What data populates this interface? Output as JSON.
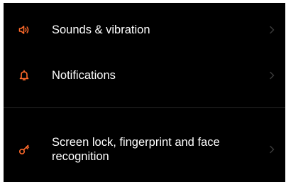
{
  "accent_color": "#ff6a2b",
  "settings": {
    "items": [
      {
        "label": "Sounds & vibration",
        "icon": "speaker-icon"
      },
      {
        "label": "Notifications",
        "icon": "bell-icon"
      },
      {
        "label": "Screen lock, fingerprint and face recognition",
        "icon": "key-icon"
      }
    ],
    "chevron_icon": "chevron-right-icon"
  }
}
